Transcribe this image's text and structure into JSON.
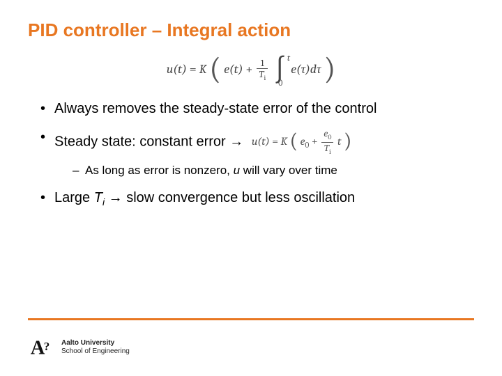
{
  "title": "PID controller – Integral action",
  "main_equation": {
    "lhs": "u(t)",
    "eq": "=",
    "K": "K",
    "e_t": "e(t)",
    "plus": "+",
    "frac_num": "1",
    "frac_den_sym": "T",
    "frac_den_sub": "i",
    "int_lower": "0",
    "int_upper": "t",
    "integrand_e": "e(τ)",
    "d": "d",
    "tau": "τ"
  },
  "bullets": [
    {
      "text": "Always removes the steady-state error of the control"
    },
    {
      "text_prefix": "Steady state: constant error ",
      "arrow": "→",
      "inline_eq": {
        "lhs": "u(t)",
        "eq": "=",
        "K": "K",
        "e0_sym": "e",
        "e0_sub": "0",
        "plus": "+",
        "frac_num_sym": "e",
        "frac_num_sub": "0",
        "frac_den_sym": "T",
        "frac_den_sub": "i",
        "t": "t"
      },
      "sub": {
        "pre": "As long as error is nonzero, ",
        "u": "u",
        "post": " will vary over time"
      }
    },
    {
      "pre": "Large ",
      "Tsym": "T",
      "Tsub": "i",
      "arrow": " → ",
      "post": "slow convergence but less oscillation"
    }
  ],
  "footer": {
    "brand_mark_letter": "A",
    "brand_mark_q": "?",
    "line1": "Aalto University",
    "line2": "School of Engineering"
  }
}
